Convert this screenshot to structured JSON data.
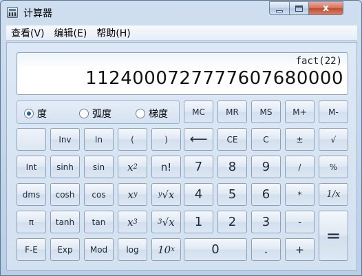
{
  "window": {
    "title": "计算器",
    "close_label": "x"
  },
  "menu": [
    {
      "label": "查看(V)"
    },
    {
      "label": "编辑(E)"
    },
    {
      "label": "帮助(H)"
    }
  ],
  "display": {
    "expression": "fact(22)",
    "value": "1124000727777607680000"
  },
  "angle_modes": [
    {
      "label": "度",
      "checked": true
    },
    {
      "label": "弧度",
      "checked": false
    },
    {
      "label": "梯度",
      "checked": false
    }
  ],
  "memory": {
    "mc": "MC",
    "mr": "MR",
    "ms": "MS",
    "mplus": "M+",
    "minus": "M-"
  },
  "row1": {
    "inv": "Inv",
    "ln": "ln",
    "lparen": "(",
    "rparen": ")",
    "back": "⟵",
    "ce": "CE",
    "c": "C",
    "pm": "±",
    "sqrt": "√"
  },
  "row2": {
    "int": "Int",
    "sinh": "sinh",
    "sin": "sin",
    "x2_base": "x",
    "x2_exp": "2",
    "fact": "n!",
    "d7": "7",
    "d8": "8",
    "d9": "9",
    "div": "/",
    "pct": "%"
  },
  "row3": {
    "dms": "dms",
    "cosh": "cosh",
    "cos": "cos",
    "xy_base": "x",
    "xy_exp": "y",
    "yroot_idx": "y",
    "yroot": "√x",
    "d4": "4",
    "d5": "5",
    "d6": "6",
    "mul": "*",
    "recip": "1/x"
  },
  "row4": {
    "pi": "π",
    "tanh": "tanh",
    "tan": "tan",
    "x3_base": "x",
    "x3_exp": "3",
    "croot_idx": "3",
    "croot": "√x",
    "d1": "1",
    "d2": "2",
    "d3": "3",
    "sub": "-",
    "eq": "="
  },
  "row5": {
    "fe": "F-E",
    "exp": "Exp",
    "mod": "Mod",
    "log": "log",
    "tenx_base": "10",
    "tenx_exp": "x",
    "d0": "0",
    "dot": ".",
    "add": "+"
  }
}
